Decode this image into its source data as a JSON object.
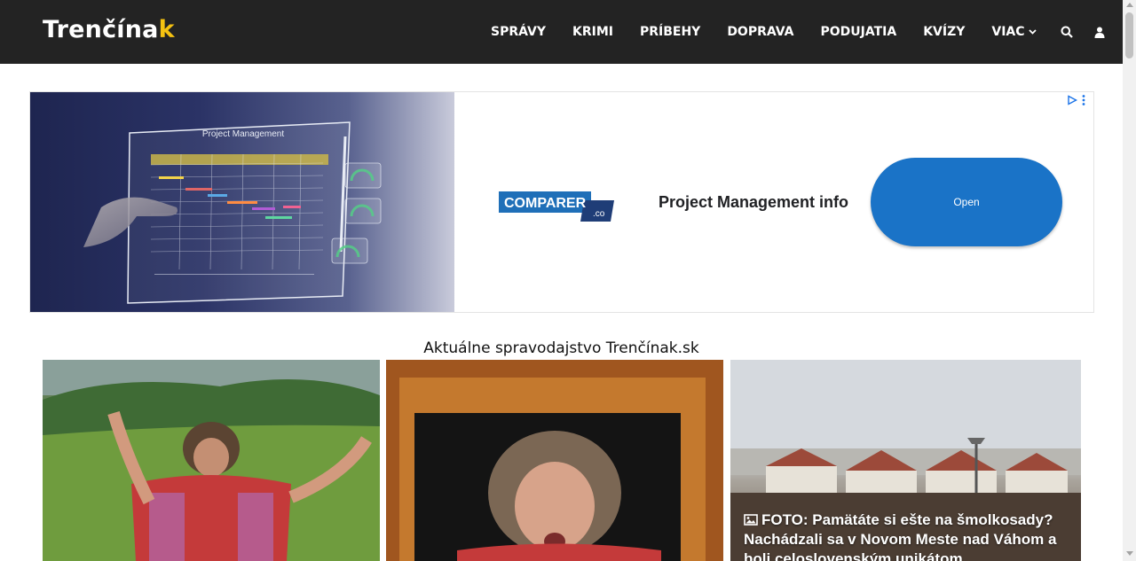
{
  "header": {
    "logo_main": "Trenčína",
    "logo_accent": "k",
    "nav": [
      "SPRÁVY",
      "KRIMI",
      "PRÍBEHY",
      "DOPRAVA",
      "PODUJATIA",
      "KVÍZY"
    ],
    "more_label": "VIAC",
    "icons": [
      "search-icon",
      "user-icon"
    ]
  },
  "ad": {
    "image_title": "Project Management",
    "brand": "COMPARER",
    "brand_suffix": ".co",
    "headline": "Project Management info",
    "button_label": "Open",
    "icons": [
      "adchoices-icon",
      "menu-dots-icon"
    ]
  },
  "section": {
    "title": "Aktuálne spravodajstvo Trenčínak.sk"
  },
  "cards": [
    {
      "caption": ""
    },
    {
      "caption": ""
    },
    {
      "caption": "FOTO: Pamätáte si ešte na šmolkosady? Nachádzali sa v Novom Meste nad Váhom a boli celoslovenským unikátom",
      "icon": "image-icon"
    }
  ],
  "colors": {
    "header_bg": "#232323",
    "logo_accent": "#f5c211",
    "ad_button": "#1a73c7"
  }
}
